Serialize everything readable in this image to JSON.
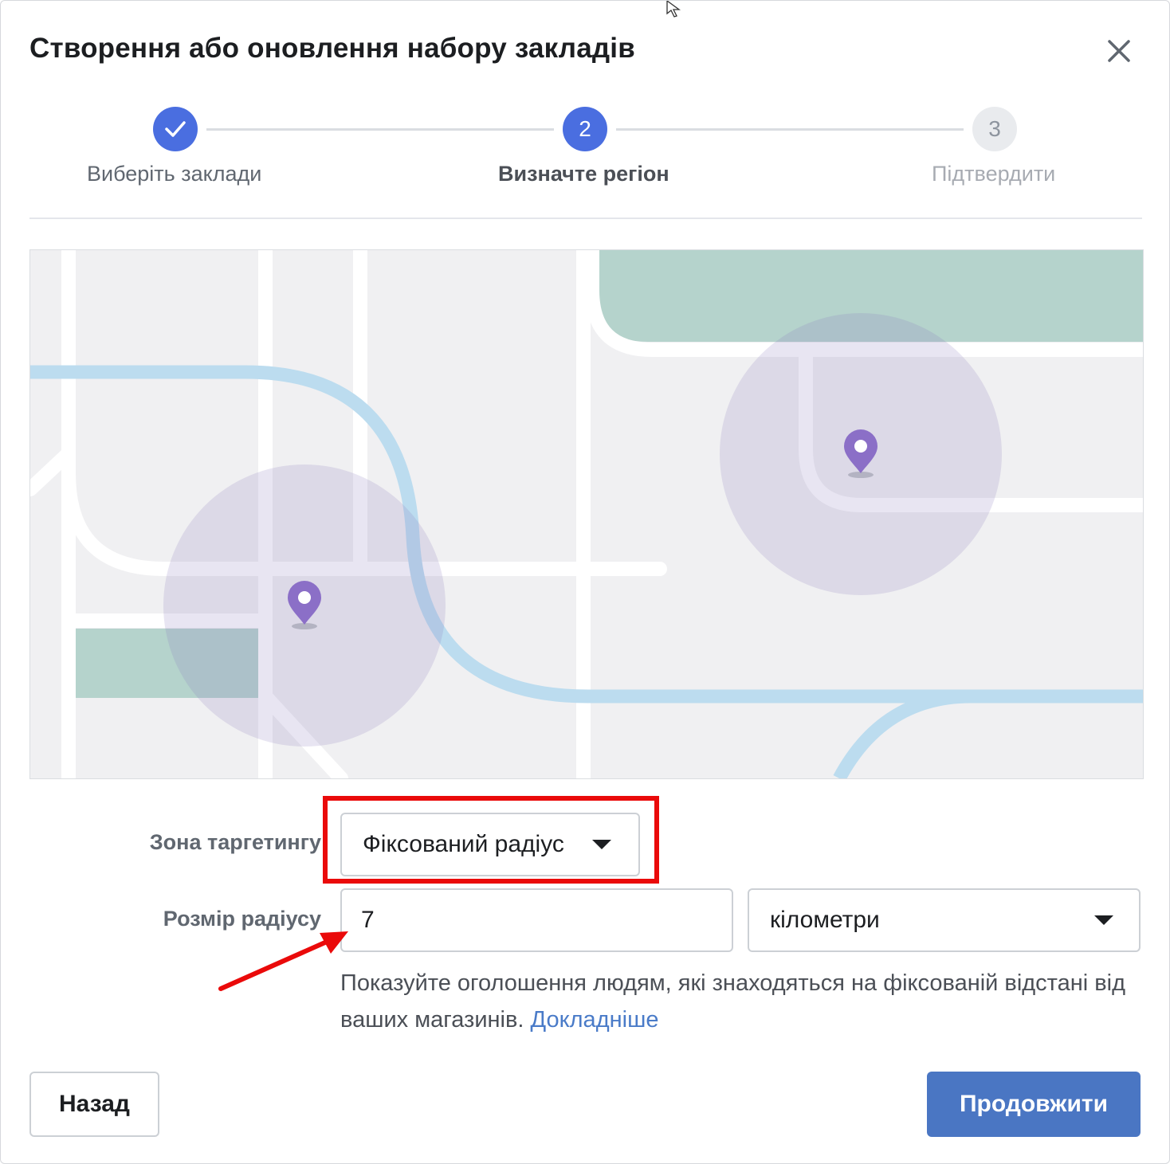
{
  "dialog": {
    "title": "Створення або оновлення набору закладів"
  },
  "stepper": {
    "steps": [
      {
        "label": "Виберіть заклади",
        "number": "1",
        "state": "done"
      },
      {
        "label": "Визначте регіон",
        "number": "2",
        "state": "active"
      },
      {
        "label": "Підтвердити",
        "number": "3",
        "state": "pending"
      }
    ]
  },
  "form": {
    "targeting_zone_label": "Зона таргетингу",
    "targeting_zone_value": "Фіксований радіус",
    "radius_label": "Розмір радіусу",
    "radius_value": "7",
    "unit_value": "кілометри",
    "help_text": "Показуйте оголошення людям, які знаходяться на фіксованій відстані від ваших магазинів.",
    "help_link": "Докладніше"
  },
  "footer": {
    "back_label": "Назад",
    "continue_label": "Продовжити"
  },
  "colors": {
    "accent": "#4a6ee0",
    "primary_button": "#4a76c3",
    "annotation_red": "#ea0a0a",
    "map_pin": "#8b6fc7"
  }
}
